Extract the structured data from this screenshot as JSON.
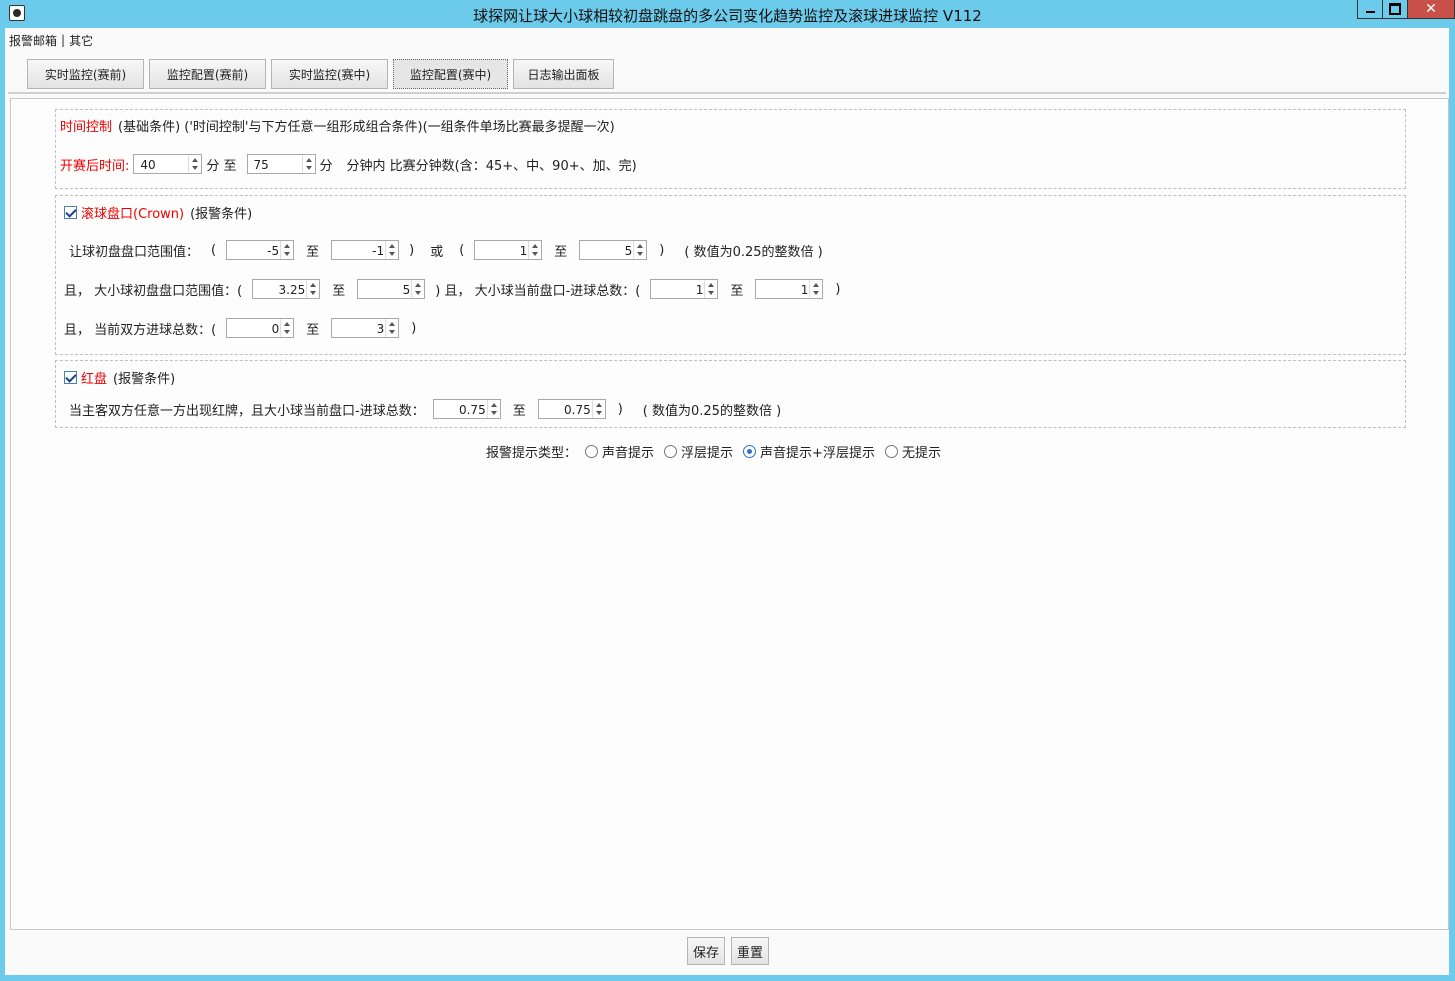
{
  "window": {
    "title": "球探网让球大小球相较初盘跳盘的多公司变化趋势监控及滚球进球监控 V112",
    "close_glyph": "✕"
  },
  "menu": {
    "items": [
      "报警邮箱",
      "其它"
    ],
    "separator": "|"
  },
  "tabs": [
    {
      "label": "实时监控(赛前)",
      "active": false
    },
    {
      "label": "监控配置(赛前)",
      "active": false
    },
    {
      "label": "实时监控(赛中)",
      "active": false
    },
    {
      "label": "监控配置(赛中)",
      "active": true
    },
    {
      "label": "日志输出面板",
      "active": false
    }
  ],
  "time_group": {
    "title_red": "时间控制",
    "title_rest": "(基础条件)  ('时间控制'与下方任意一组形成组合条件)(一组条件单场比赛最多提醒一次)",
    "row_label": "开赛后时间:",
    "from": "40",
    "unit1": "分 至",
    "to": "75",
    "unit2": "分",
    "note": "分钟内 比赛分钟数(含：45+、中、90+、加、完)"
  },
  "crown_group": {
    "checked": true,
    "title_red": "滚球盘口(Crown)",
    "title_rest": "(报警条件)",
    "row1": {
      "label": "让球初盘盘口范围值：",
      "paren_open": "(",
      "a": "-5",
      "to": "至",
      "b": "-1",
      "paren_close": ")",
      "or": "或",
      "c": "1",
      "d": "5",
      "note": "( 数值为0.25的整数倍 )"
    },
    "row2": {
      "label": "且，  大小球初盘盘口范围值：(",
      "a": "3.25",
      "to": "至",
      "b": "5",
      "mid": ") 且，  大小球当前盘口-进球总数：(",
      "c": "1",
      "d": "1",
      "close": ")"
    },
    "row3": {
      "label": "且，  当前双方进球总数：(",
      "a": "0",
      "to": "至",
      "b": "3",
      "close": ")"
    }
  },
  "red_group": {
    "checked": true,
    "title_red": "红盘",
    "title_rest": "(报警条件)",
    "row_label": "当主客双方任意一方出现红牌，且大小球当前盘口-进球总数：",
    "a": "0.75",
    "to": "至",
    "b": "0.75",
    "close": ")",
    "note": "( 数值为0.25的整数倍 )"
  },
  "alert": {
    "label": "报警提示类型：",
    "options": [
      {
        "label": "声音提示",
        "selected": false
      },
      {
        "label": "浮层提示",
        "selected": false
      },
      {
        "label": "声音提示+浮层提示",
        "selected": true
      },
      {
        "label": "无提示",
        "selected": false
      }
    ]
  },
  "buttons": {
    "save": "保存",
    "reset": "重置"
  }
}
